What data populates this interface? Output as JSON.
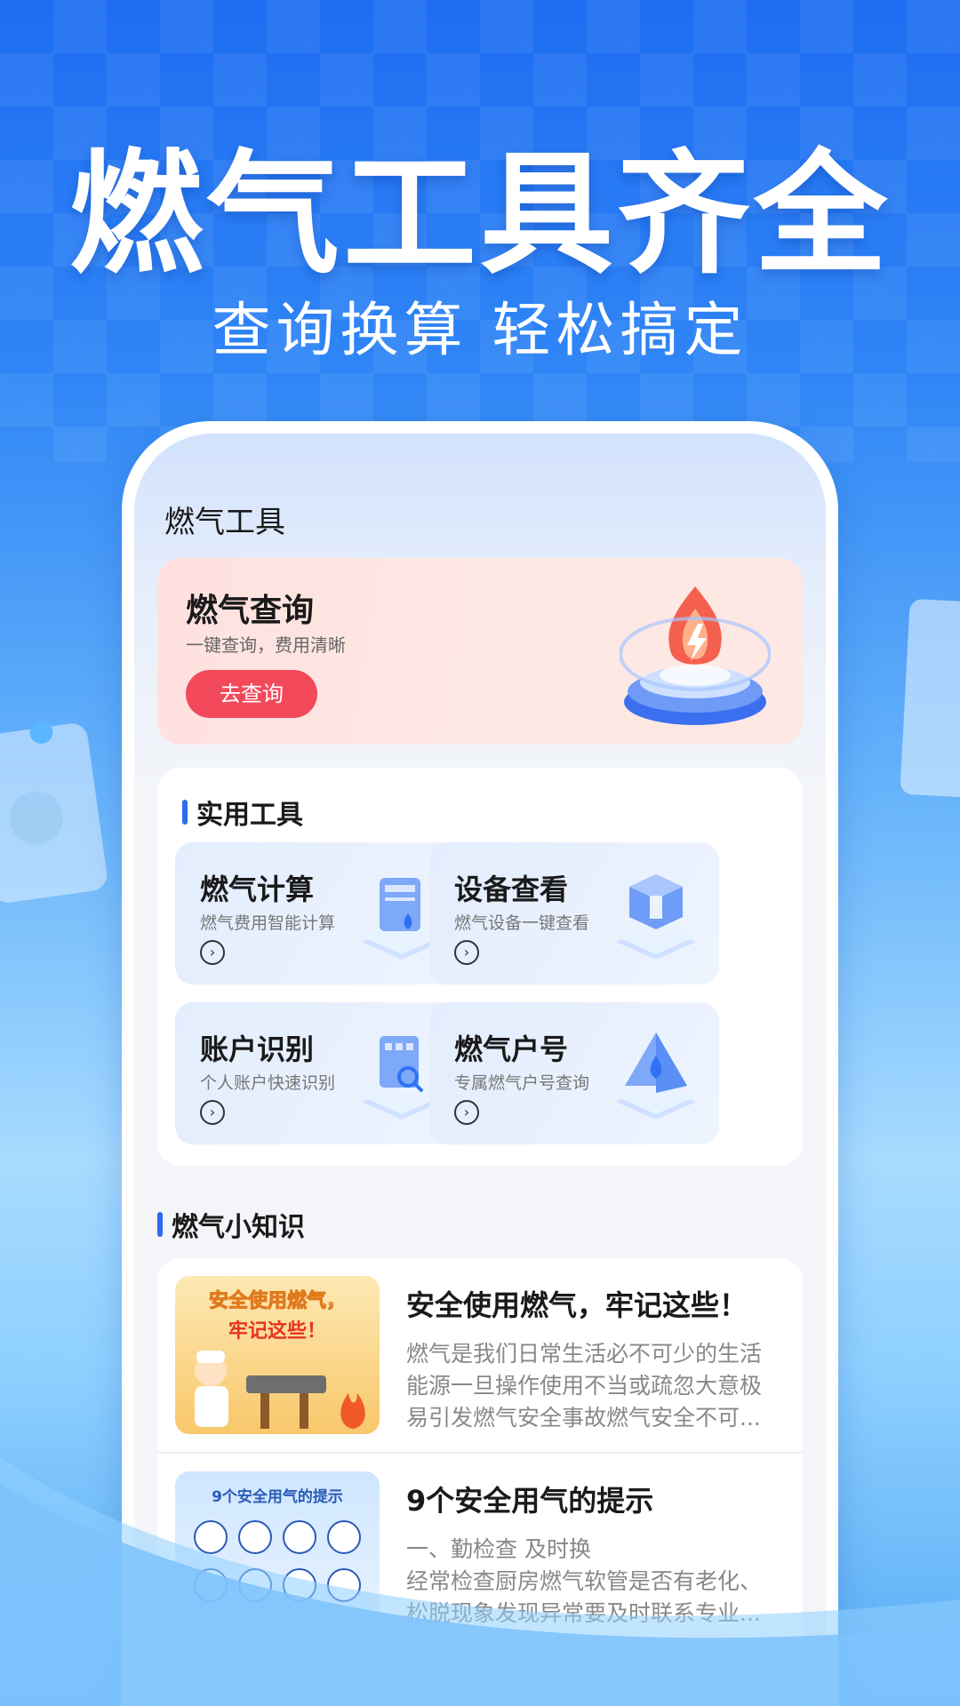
{
  "hero": {
    "title": "燃气工具齐全",
    "subtitle": "查询换算 轻松搞定"
  },
  "app": {
    "page_title": "燃气工具",
    "query_card": {
      "title": "燃气查询",
      "description": "一键查询，费用清晰",
      "button_label": "去查询"
    },
    "tools_section": {
      "heading": "实用工具",
      "tiles": [
        {
          "title": "燃气计算",
          "description": "燃气费用智能计算",
          "icon": "calculator-icon"
        },
        {
          "title": "设备查看",
          "description": "燃气设备一键查看",
          "icon": "device-cube-icon"
        },
        {
          "title": "账户识别",
          "description": "个人账户快速识别",
          "icon": "account-scan-icon"
        },
        {
          "title": "燃气户号",
          "description": "专属燃气户号查询",
          "icon": "water-drop-pyramid-icon"
        }
      ]
    },
    "knowledge_section": {
      "heading": "燃气小知识",
      "articles": [
        {
          "title": "安全使用燃气，牢记这些！",
          "lines": [
            "燃气是我们日常生活必不可少的生活",
            "能源一旦操作使用不当或疏忽大意极",
            "易引发燃气安全事故燃气安全不可..."
          ],
          "thumb_text_1": "安全使用燃气，",
          "thumb_text_2": "牢记这些！"
        },
        {
          "title": "9个安全用气的提示",
          "lines": [
            "一、勤检查 及时换",
            "经常检查厨房燃气软管是否有老化、",
            "松脱现象发现异常要及时联系专业..."
          ],
          "thumb_text_1": "9个安全用气的提示"
        }
      ]
    }
  },
  "colors": {
    "accent_blue": "#2d6bf5",
    "query_button": "#f2495b",
    "hero_text": "#ffffff"
  }
}
